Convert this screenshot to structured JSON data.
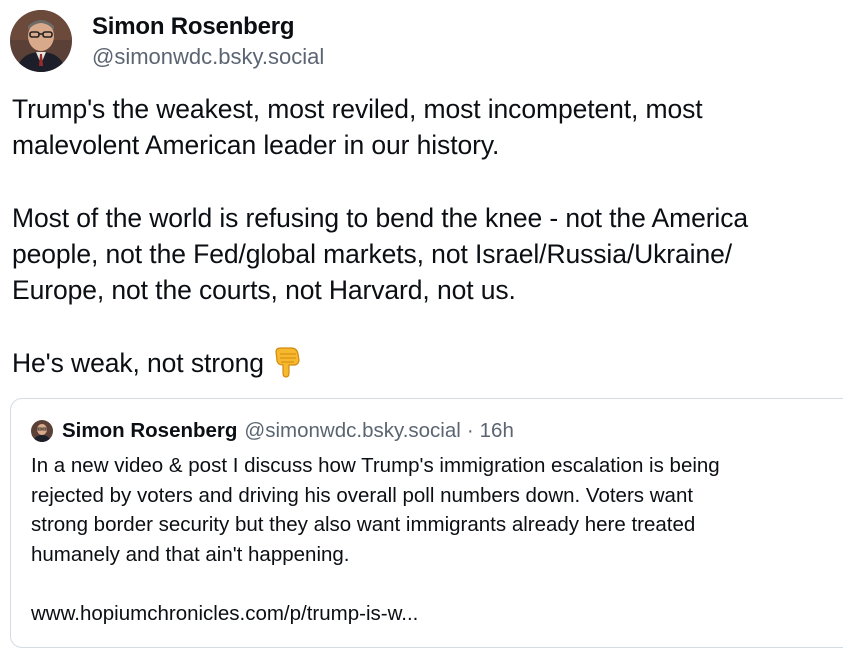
{
  "post": {
    "author": {
      "display_name": "Simon Rosenberg",
      "handle": "@simonwdc.bsky.social"
    },
    "paragraphs": [
      [
        "Trump's the weakest, most reviled, most incompetent, most",
        "malevolent American leader in our history."
      ],
      [
        "Most of the world is refusing to bend the knee - not the America",
        "people, not the Fed/global markets, not Israel/Russia/Ukraine/",
        "Europe, not the courts, not Harvard, not us."
      ],
      [
        "He's weak, not strong"
      ]
    ],
    "emoji": "backhand-index-pointing-down",
    "quote": {
      "display_name": "Simon Rosenberg",
      "handle": "@simonwdc.bsky.social",
      "separator": "·",
      "time": "16h",
      "lines": [
        "In a new video & post I discuss how Trump's immigration escalation is being",
        "rejected by voters and driving his overall poll numbers down. Voters want",
        "strong border security but they also want immigrants already here treated",
        "humanely and that ain't happening."
      ],
      "link": "www.hopiumchronicles.com/p/trump-is-w..."
    }
  },
  "colors": {
    "text": "#0b0f14",
    "muted": "#5b6572",
    "border": "#d4dbe2"
  }
}
